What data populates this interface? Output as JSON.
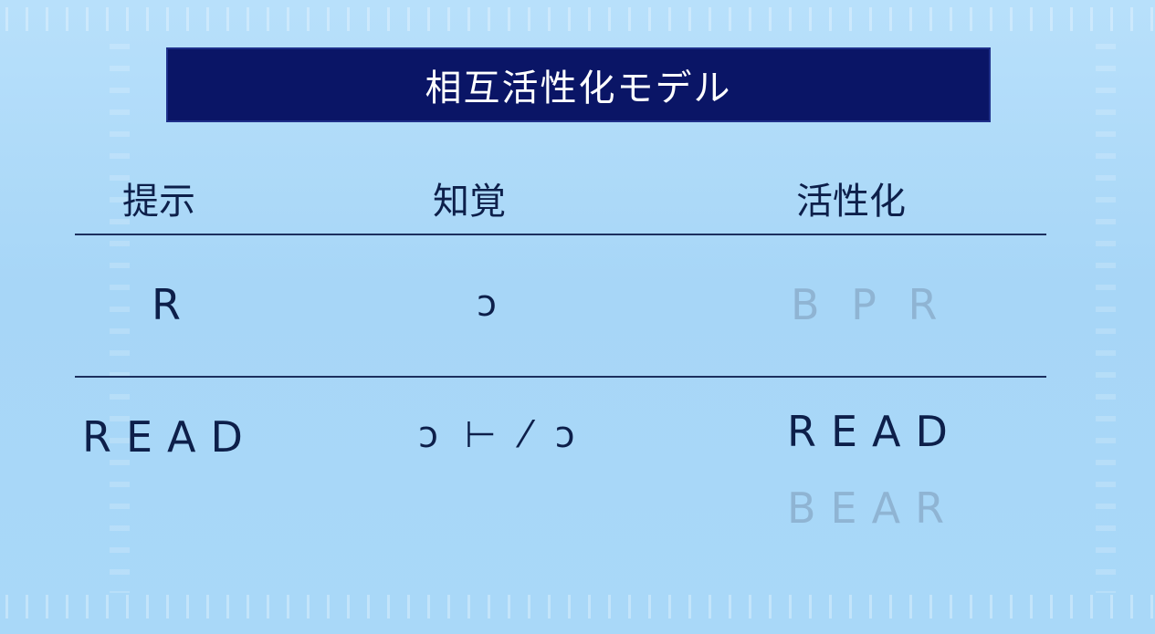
{
  "title": "相互活性化モデル",
  "headers": {
    "presentation": "提示",
    "perception": "知覚",
    "activation": "活性化"
  },
  "rows": [
    {
      "presentation": "R",
      "perception": "ɔ",
      "activation": [
        "B P R"
      ]
    },
    {
      "presentation": "READ",
      "perception": "ɔ ⊢ ⁄ ɔ",
      "activation": [
        "READ",
        "BEAR"
      ]
    }
  ],
  "colors": {
    "title_bg": "#0a1566",
    "text": "#0d1f4a",
    "faded_text": "#8fb4d3",
    "background": "#a9d8f8"
  }
}
